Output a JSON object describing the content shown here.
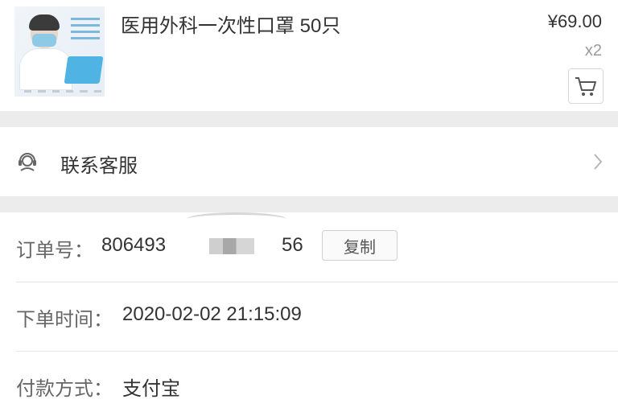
{
  "product": {
    "title": "医用外科一次性口罩 50只",
    "price": "¥69.00",
    "quantity": "x2"
  },
  "service": {
    "label": "联系客服"
  },
  "order": {
    "number_label": "订单号：",
    "number_part1": "806493",
    "number_part2": "56",
    "copy_label": "复制",
    "time_label": "下单时间：",
    "time_value": "2020-02-02 21:15:09",
    "payment_label": "付款方式：",
    "payment_value": "支付宝"
  },
  "icons": {
    "cart": "cart-icon",
    "service": "headset-icon",
    "chevron": "chevron-right-icon"
  }
}
